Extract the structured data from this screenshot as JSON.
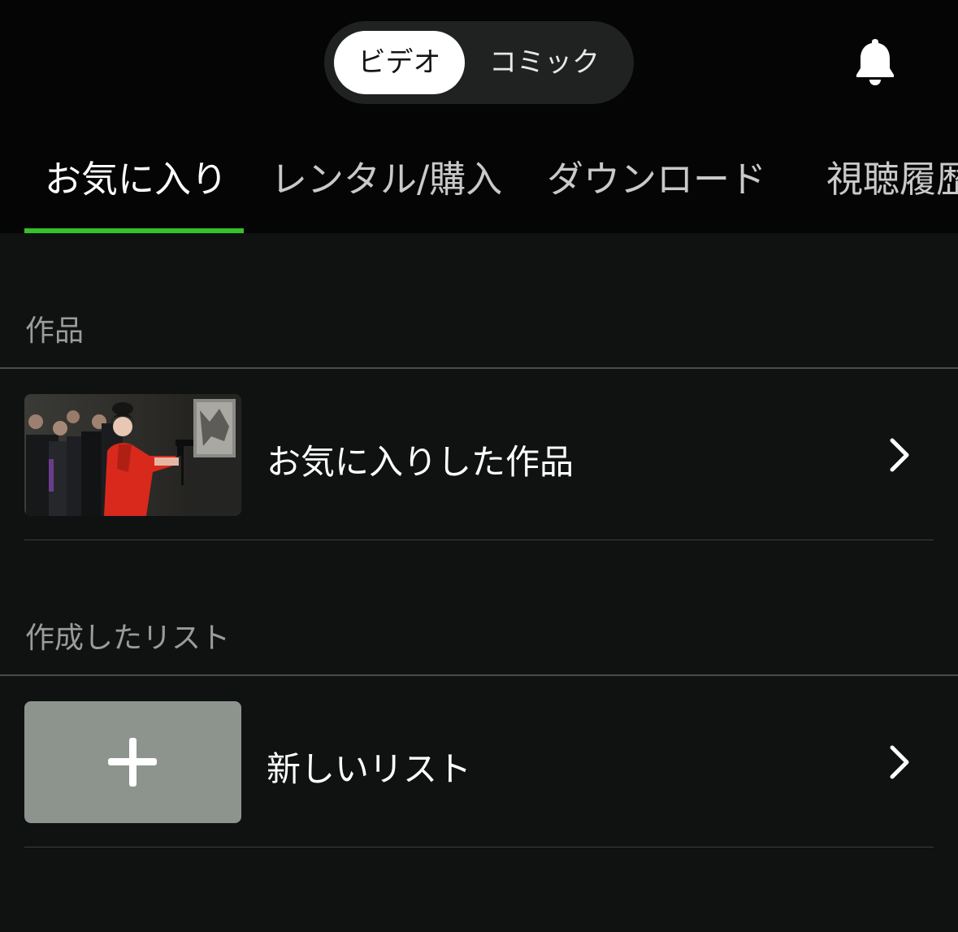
{
  "header": {
    "segment": {
      "video_label": "ビデオ",
      "comic_label": "コミック",
      "selected": "ビデオ"
    },
    "icons": {
      "notifications": "bell-icon"
    }
  },
  "tabs": [
    {
      "label": "お気に入り",
      "active": true
    },
    {
      "label": "レンタル/購入",
      "active": false
    },
    {
      "label": "ダウンロード",
      "active": false
    },
    {
      "label": "視聴履歴",
      "active": false
    }
  ],
  "sections": {
    "works": {
      "label": "作品",
      "item": {
        "title": "お気に入りした作品",
        "thumbnail": "film-still-thumbnail",
        "icon": "chevron-right-icon"
      }
    },
    "lists": {
      "label": "作成したリスト",
      "item": {
        "title": "新しいリスト",
        "thumbnail": "plus-icon",
        "icon": "chevron-right-icon"
      }
    }
  },
  "colors": {
    "accent": "#35c22b",
    "background": "#101211",
    "header_background": "#050505",
    "plus_tile": "#8c948d"
  }
}
